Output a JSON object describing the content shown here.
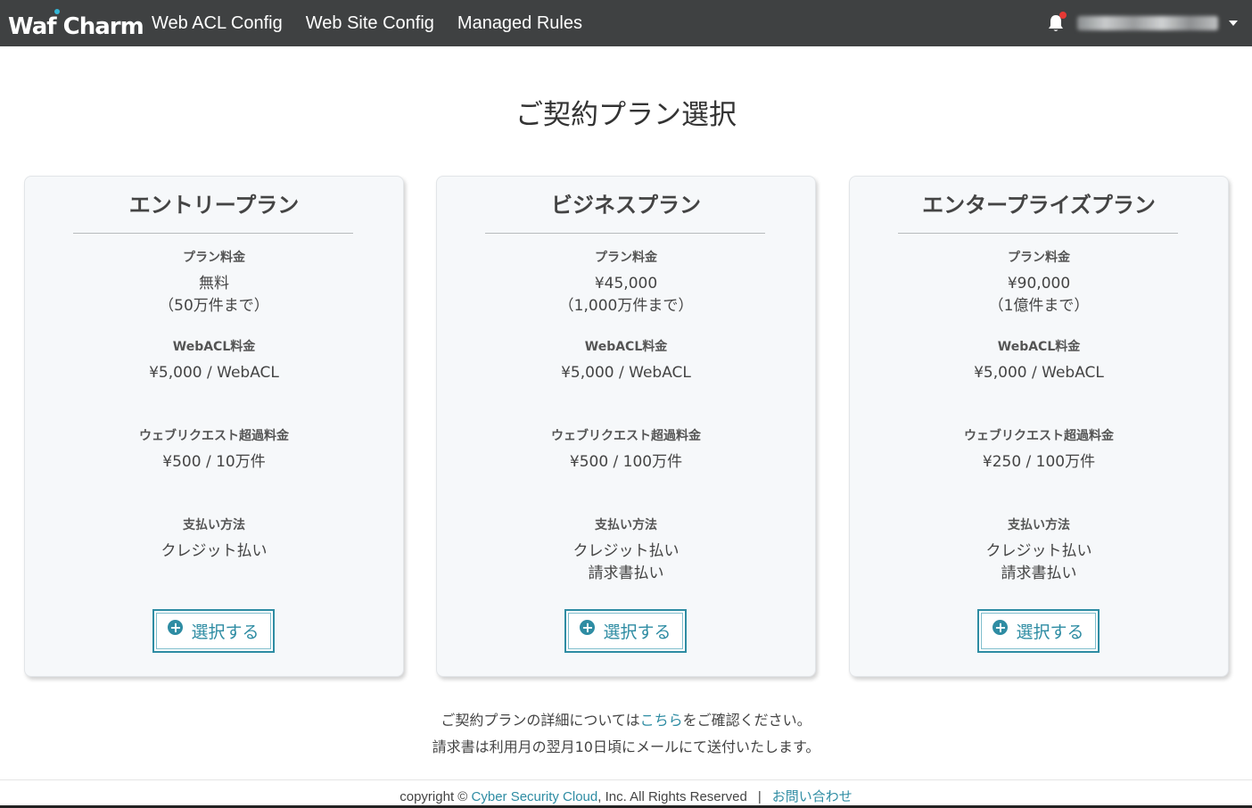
{
  "navbar": {
    "brand": "Waf Charm",
    "links": [
      "Web ACL Config",
      "Web Site Config",
      "Managed Rules"
    ],
    "user_name": "",
    "bell_icon": "bell-icon",
    "caret_icon": "chevron-down-icon"
  },
  "page": {
    "title": "ご契約プラン選択"
  },
  "labels": {
    "price": "プラン料金",
    "webacl": "WebACL料金",
    "overage": "ウェブリクエスト超過料金",
    "payment": "支払い方法"
  },
  "plans": [
    {
      "name": "エントリープラン",
      "price": "無料",
      "price_note": "（50万件まで）",
      "webacl": "¥5,000 / WebACL",
      "overage": "¥500 / 10万件",
      "payment": [
        "クレジット払い",
        ""
      ],
      "button": "選択する"
    },
    {
      "name": "ビジネスプラン",
      "price": "¥45,000",
      "price_note": "（1,000万件まで）",
      "webacl": "¥5,000 / WebACL",
      "overage": "¥500 / 100万件",
      "payment": [
        "クレジット払い",
        "請求書払い"
      ],
      "button": "選択する"
    },
    {
      "name": "エンタープライズプラン",
      "price": "¥90,000",
      "price_note": "（1億件まで）",
      "webacl": "¥5,000 / WebACL",
      "overage": "¥250 / 100万件",
      "payment": [
        "クレジット払い",
        "請求書払い"
      ],
      "button": "選択する"
    }
  ],
  "notes": {
    "line1_before": "ご契約プランの詳細については",
    "line1_link": "こちら",
    "line1_after": "をご確認ください。",
    "line2": "請求書は利用月の翌月10日頃にメールにて送付いたします。"
  },
  "footer": {
    "copyright": "copyright ©",
    "company_link": "Cyber Security Cloud",
    "rights": ", Inc. All Rights Reserved",
    "separator": "|",
    "contact_link": "お問い合わせ"
  },
  "colors": {
    "navbar": "#3f4142",
    "accent": "#2e8ca3",
    "card_bg": "#f6f8fa",
    "notification": "#e53935"
  }
}
